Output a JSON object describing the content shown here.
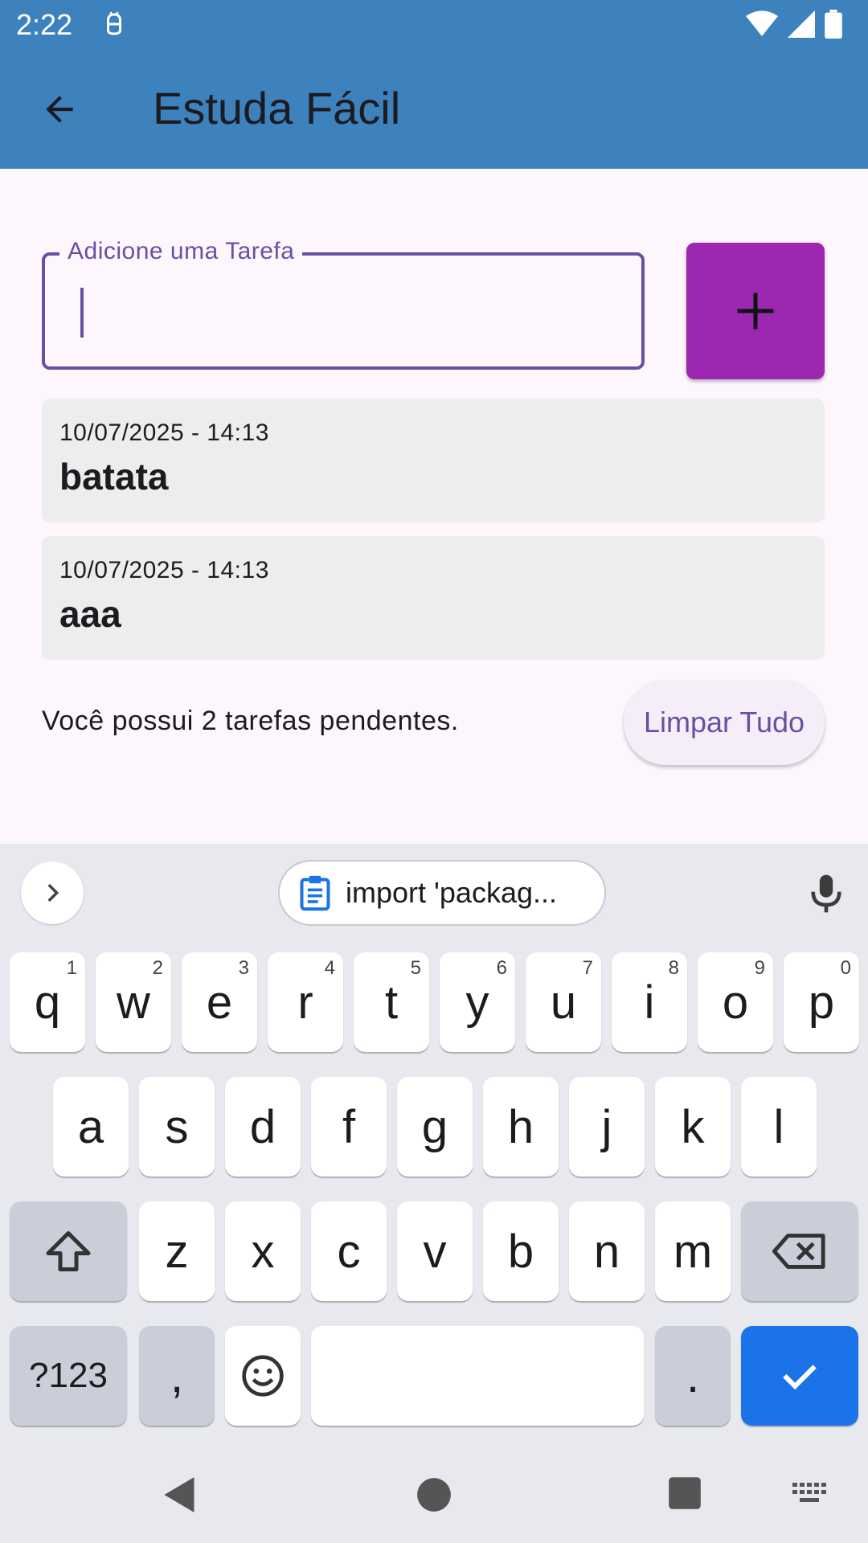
{
  "status_bar": {
    "time": "2:22"
  },
  "app_bar": {
    "title": "Estuda Fácil"
  },
  "task_input": {
    "label": "Adicione uma Tarefa",
    "value": ""
  },
  "tasks": [
    {
      "date": "10/07/2025 - 14:13",
      "name": "batata"
    },
    {
      "date": "10/07/2025 - 14:13",
      "name": "aaa"
    }
  ],
  "footer": {
    "pending_text": "Você possui 2 tarefas pendentes.",
    "clear_label": "Limpar Tudo"
  },
  "keyboard": {
    "clipboard_suggestion": "import 'packag...",
    "row1": [
      {
        "key": "q",
        "hint": "1"
      },
      {
        "key": "w",
        "hint": "2"
      },
      {
        "key": "e",
        "hint": "3"
      },
      {
        "key": "r",
        "hint": "4"
      },
      {
        "key": "t",
        "hint": "5"
      },
      {
        "key": "y",
        "hint": "6"
      },
      {
        "key": "u",
        "hint": "7"
      },
      {
        "key": "i",
        "hint": "8"
      },
      {
        "key": "o",
        "hint": "9"
      },
      {
        "key": "p",
        "hint": "0"
      }
    ],
    "row2": [
      "a",
      "s",
      "d",
      "f",
      "g",
      "h",
      "j",
      "k",
      "l"
    ],
    "row3": [
      "z",
      "x",
      "c",
      "v",
      "b",
      "n",
      "m"
    ],
    "symbols_label": "?123",
    "comma": ",",
    "period": "."
  },
  "colors": {
    "app_bar": "#3d82bd",
    "accent": "#6750a4",
    "add_button": "#9c27b0",
    "enter_key": "#1a73e8"
  }
}
